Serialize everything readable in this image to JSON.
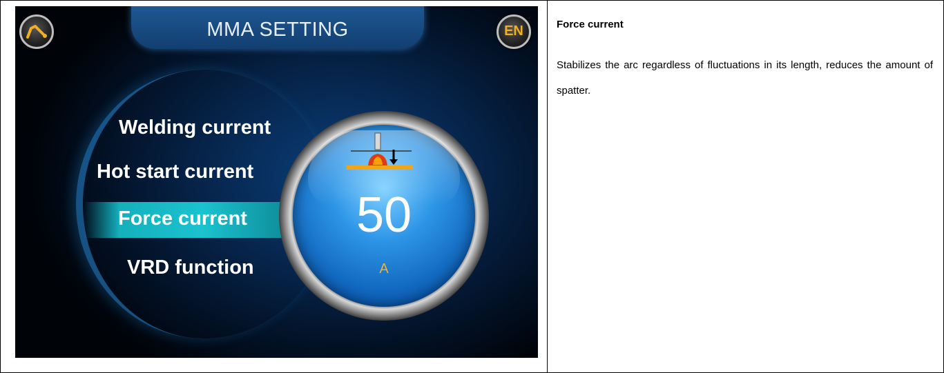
{
  "screen": {
    "title": "MMA SETTING",
    "language_label": "EN",
    "menu": [
      {
        "label": "Welding current"
      },
      {
        "label": "Hot start current"
      },
      {
        "label": "Force current",
        "selected": true
      },
      {
        "label": "VRD function"
      }
    ],
    "value": "50",
    "unit": "A",
    "icons": {
      "home": "welding-torch-icon",
      "language": "language-icon",
      "parameter": "force-current-icon"
    },
    "colors": {
      "highlight": "#1ac3cf",
      "unit": "#f2b32a",
      "language": "#f0b020"
    }
  },
  "info": {
    "title": "Force current",
    "description": "Stabilizes the arc regardless of fluctuations in its length, reduces the amount of spatter."
  }
}
